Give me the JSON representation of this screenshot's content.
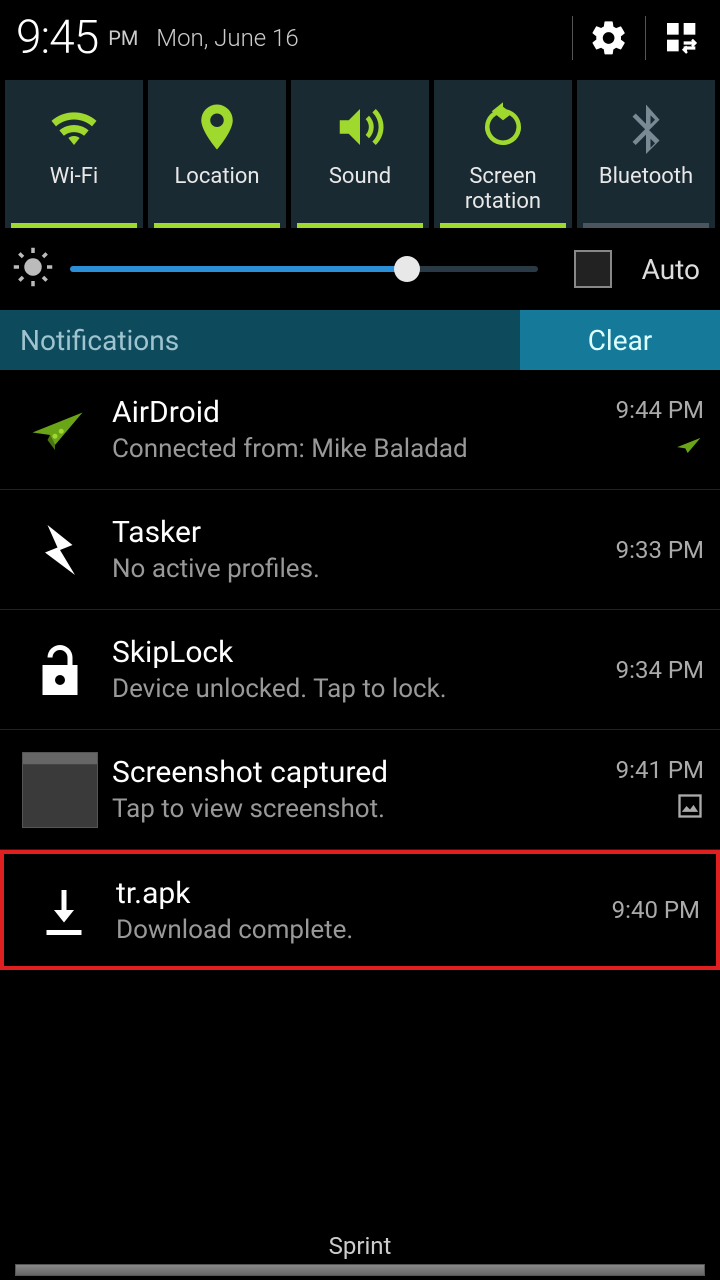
{
  "status": {
    "time": "9:45",
    "ampm": "PM",
    "date": "Mon, June 16"
  },
  "toggles": [
    {
      "label": "Wi-Fi",
      "active": true
    },
    {
      "label": "Location",
      "active": true
    },
    {
      "label": "Sound",
      "active": true
    },
    {
      "label": "Screen\nrotation",
      "active": true
    },
    {
      "label": "Bluetooth",
      "active": false
    }
  ],
  "brightness": {
    "auto_label": "Auto",
    "percent": 72
  },
  "notif_header": {
    "title": "Notifications",
    "clear": "Clear"
  },
  "notifications": [
    {
      "title": "AirDroid",
      "sub": "Connected from: Mike Baladad",
      "time": "9:44 PM",
      "icon": "airdroid",
      "trailing": "airdroid-small"
    },
    {
      "title": "Tasker",
      "sub": "No active profiles.",
      "time": "9:33 PM",
      "icon": "bolt"
    },
    {
      "title": "SkipLock",
      "sub": "Device unlocked. Tap to lock.",
      "time": "9:34 PM",
      "icon": "lock-open"
    },
    {
      "title": "Screenshot captured",
      "sub": "Tap to view screenshot.",
      "time": "9:41 PM",
      "icon": "thumbnail",
      "trailing": "image-icon"
    },
    {
      "title": "tr.apk",
      "sub": "Download complete.",
      "time": "9:40 PM",
      "icon": "download",
      "highlighted": true
    }
  ],
  "carrier": "Sprint"
}
